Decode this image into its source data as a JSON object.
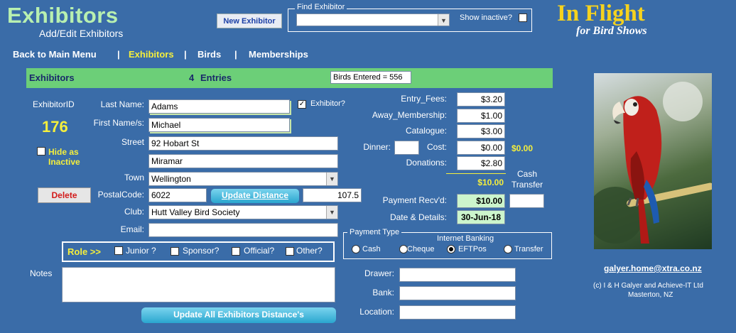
{
  "header": {
    "title": "Exhibitors",
    "subtitle": "Add/Edit Exhibitors",
    "new_exhibitor_label": "New Exhibitor",
    "find_exhibitor_legend": "Find Exhibitor",
    "find_exhibitor_value": "",
    "show_inactive_label": "Show inactive?",
    "brand_title": "In Flight",
    "brand_subtitle": "for Bird Shows"
  },
  "nav": {
    "back": "Back to Main Menu",
    "sep": "|",
    "items": [
      "Exhibitors",
      "Birds",
      "Memberships"
    ]
  },
  "bar": {
    "title": "Exhibitors",
    "count": "4",
    "entries_label": "Entries",
    "birds_entered": "Birds Entered = 556"
  },
  "form": {
    "exhibitor_id_label": "ExhibitorID",
    "exhibitor_id": "176",
    "hide_inactive_label_1": "Hide as",
    "hide_inactive_label_2": "Inactive",
    "delete_label": "Delete",
    "last_name_label": "Last Name:",
    "last_name": "Adams",
    "exhibitor_check_label": "Exhibitor?",
    "first_name_label": "First Name/s:",
    "first_name": "Michael",
    "street_label": "Street",
    "street_1": "92 Hobart St",
    "street_2": "Miramar",
    "town_label": "Town",
    "town": "Wellington",
    "postal_label": "PostalCode:",
    "postal": "6022",
    "update_distance_label": "Update Distance",
    "distance": "107.5",
    "club_label": "Club:",
    "club": "Hutt Valley Bird Society",
    "email_label": "Email:",
    "email": "",
    "role_label": "Role >>",
    "roles": [
      "Junior ?",
      "Sponsor?",
      "Official?",
      "Other?"
    ],
    "notes_label": "Notes",
    "notes": "",
    "update_all_label": "Update All Exhibitors Distance's"
  },
  "fees": {
    "entry_fees_label": "Entry_Fees:",
    "entry_fees": "$3.20",
    "away_label": "Away_Membership:",
    "away": "$1.00",
    "catalogue_label": "Catalogue:",
    "catalogue": "$3.00",
    "dinner_label": "Dinner:",
    "dinner": "",
    "cost_label": "Cost:",
    "cost": "$0.00",
    "cost_extra": "$0.00",
    "donations_label": "Donations:",
    "donations": "$2.80",
    "total": "$10.00",
    "cash_transfer_label_1": "Cash",
    "cash_transfer_label_2": "Transfer",
    "cash_transfer": "",
    "payment_label": "Payment Recv'd:",
    "payment": "$10.00",
    "date_label": "Date & Details:",
    "date": "30-Jun-18"
  },
  "payment_type": {
    "legend": "Payment Type",
    "internet_banking": "Internet Banking",
    "options": [
      "Cash",
      "Cheque",
      "EFTPos",
      "Transfer"
    ],
    "selected": "EFTPos"
  },
  "cheque": {
    "drawer_label": "Drawer:",
    "drawer": "",
    "bank_label": "Bank:",
    "bank": "",
    "location_label": "Location:",
    "location": ""
  },
  "footer": {
    "email_link": "galyer.home@xtra.co.nz",
    "copyright": "(c) I & H Galyer and Achieve-IT Ltd",
    "location": "Masterton, NZ"
  },
  "colors": {
    "background": "#3a6ca8",
    "bar_green": "#6ccf78",
    "title_green": "#b8f0b0",
    "brand_yellow": "#f5d21e",
    "value_yellow": "#f5ef3c"
  }
}
